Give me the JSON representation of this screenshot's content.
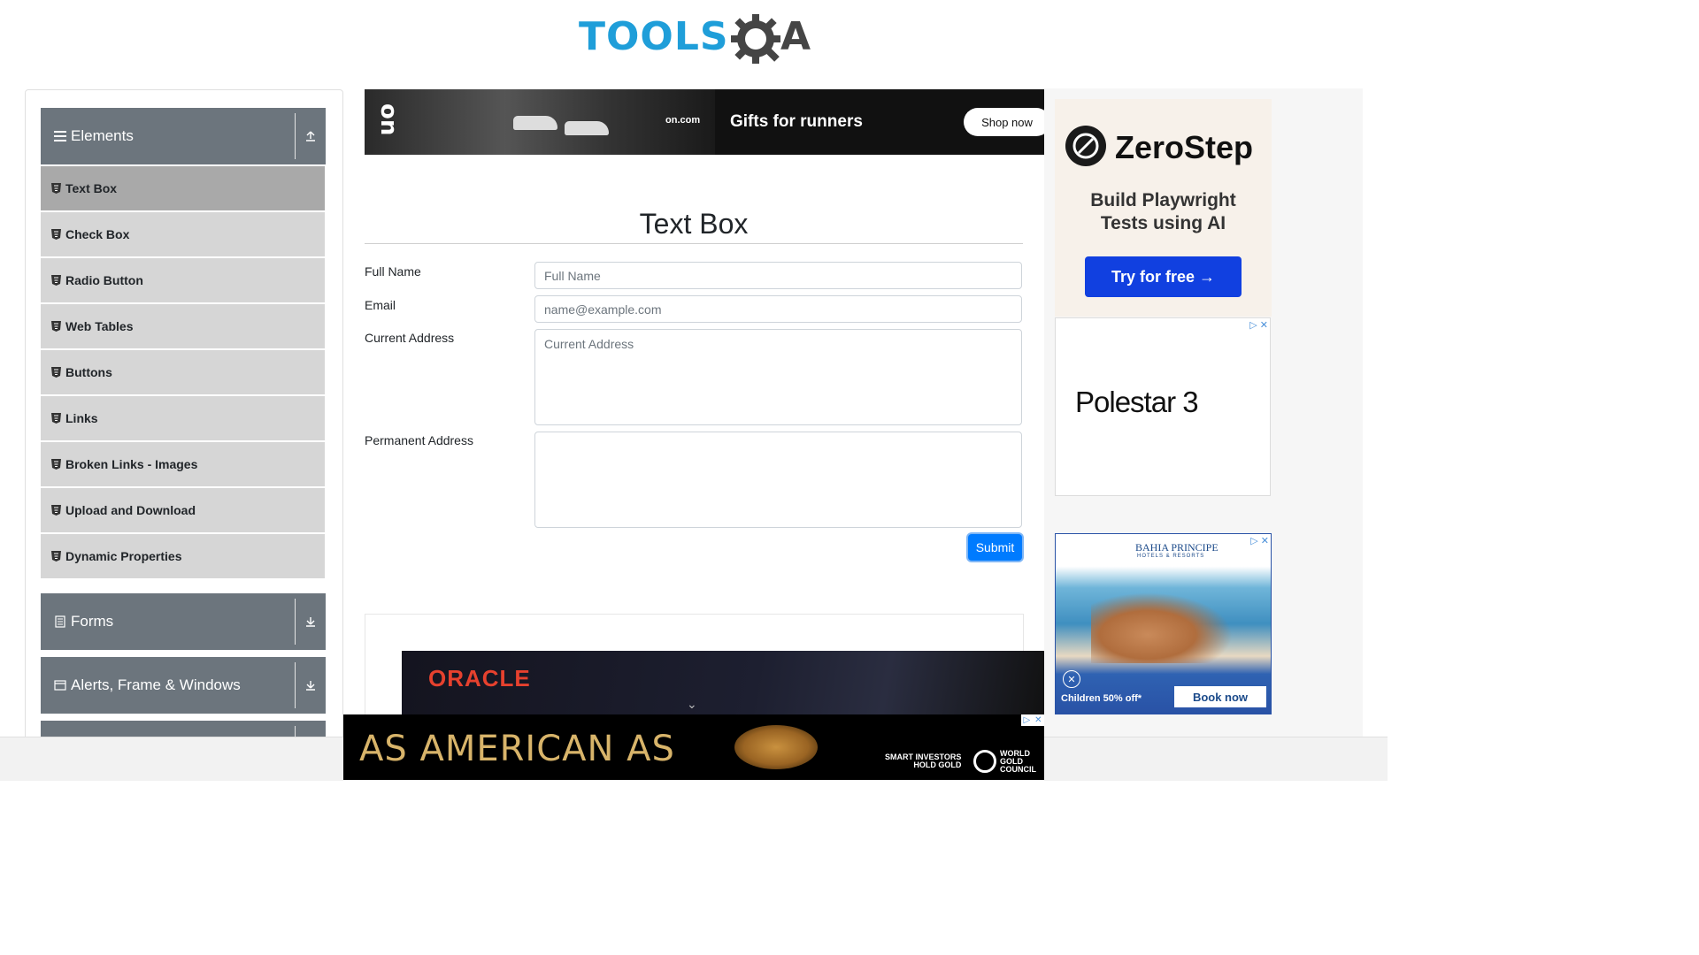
{
  "logo": {
    "text": "TOOLS",
    "a": "A"
  },
  "sidebar": {
    "groups": [
      {
        "label": "Elements",
        "icon": "menu-icon",
        "toggle": "collapse-up-icon"
      },
      {
        "label": "Forms",
        "icon": "document-icon",
        "toggle": "expand-down-icon"
      },
      {
        "label": "Alerts, Frame & Windows",
        "icon": "window-icon",
        "toggle": "expand-down-icon"
      }
    ],
    "items": [
      "Text Box",
      "Check Box",
      "Radio Button",
      "Web Tables",
      "Buttons",
      "Links",
      "Broken Links - Images",
      "Upload and Download",
      "Dynamic Properties"
    ],
    "active_item": "Text Box"
  },
  "ad_top": {
    "brand": "on.com",
    "headline": "Gifts for runners",
    "cta": "Shop now"
  },
  "main": {
    "title": "Text Box",
    "fields": {
      "full_name": {
        "label": "Full Name",
        "placeholder": "Full Name"
      },
      "email": {
        "label": "Email",
        "placeholder": "name@example.com"
      },
      "current_address": {
        "label": "Current Address",
        "placeholder": "Current Address"
      },
      "permanent_address": {
        "label": "Permanent Address",
        "placeholder": ""
      }
    },
    "submit_label": "Submit"
  },
  "ad_oracle": {
    "brand": "ORACLE"
  },
  "ad_bottom": {
    "headline": "AS AMERICAN AS",
    "smart": "SMART INVESTORS\nHOLD GOLD",
    "council": "WORLD\nGOLD\nCOUNCIL"
  },
  "ad_zerostep": {
    "brand": "ZeroStep",
    "tagline_1": "Build Playwright",
    "tagline_2": "Tests using AI",
    "cta": "Try for free →"
  },
  "ad_polestar": {
    "brand": "Polestar 3"
  },
  "ad_bahia": {
    "brand": "BAHIA PRINCIPE",
    "brand_sub": "HOTELS & RESORTS",
    "offer": "Children 50% off*",
    "cta": "Book now"
  },
  "colors": {
    "primary": "#007bff",
    "sidebar_header": "#6c757d",
    "sidebar_item": "#d6d6d6",
    "sidebar_active": "#a9a9a9",
    "logo_blue": "#1f9ed9"
  }
}
